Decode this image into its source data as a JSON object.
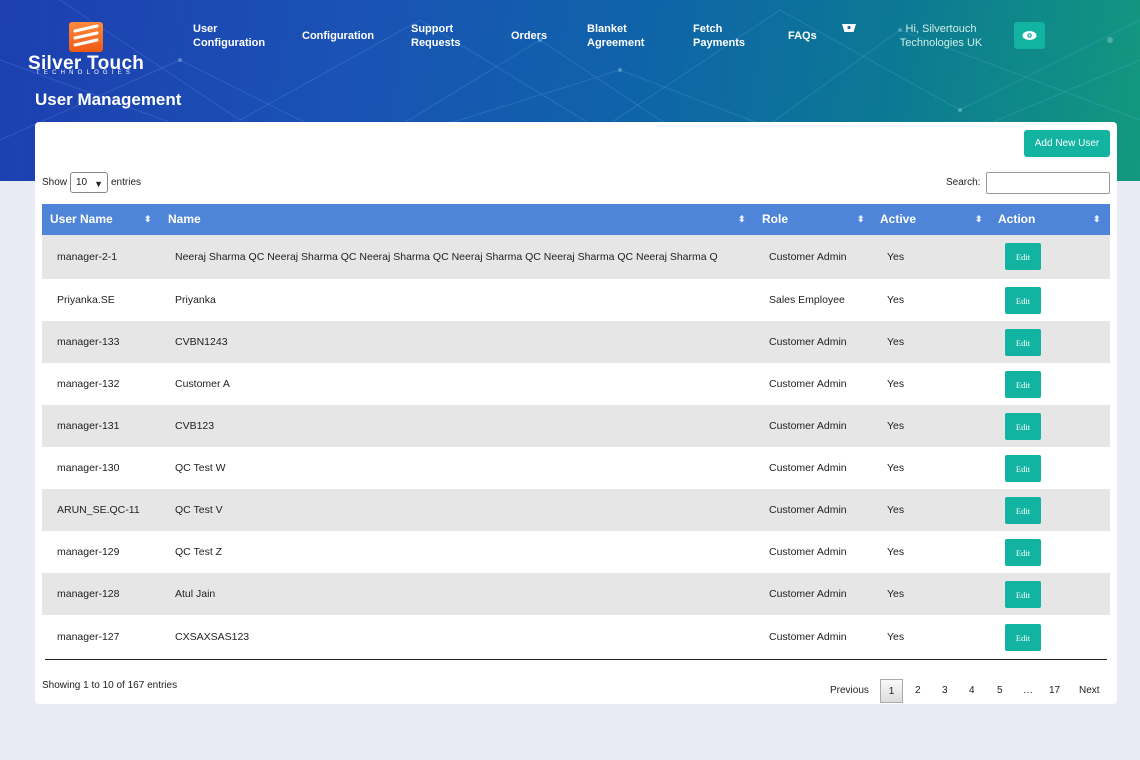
{
  "brand": {
    "name": "Silver Touch",
    "tagline": "TECHNOLOGIES",
    "accent": "#12b3a0",
    "header_blue": "#1d3fb0",
    "table_header": "#4f85d8"
  },
  "nav": [
    {
      "label": "User\nConfiguration"
    },
    {
      "label": "Configuration"
    },
    {
      "label": "Support\nRequests"
    },
    {
      "label": "Orders"
    },
    {
      "label": "Blanket\nAgreement"
    },
    {
      "label": "Fetch\nPayments"
    },
    {
      "label": "FAQs"
    }
  ],
  "header": {
    "greeting": "Hi, Silvertouch\nTechnologies UK",
    "basket_icon": "basket-icon",
    "eye_icon": "eye-icon"
  },
  "page": {
    "title": "User Management",
    "add_button": "Add New User"
  },
  "table_controls": {
    "show_label": "Show",
    "entries_value": "10",
    "entries_label": "entries",
    "search_label": "Search:",
    "search_value": ""
  },
  "columns": [
    "User Name",
    "Name",
    "Role",
    "Active",
    "Action"
  ],
  "rows": [
    {
      "username": "manager-2-1",
      "name": "Neeraj Sharma QC Neeraj Sharma QC Neeraj Sharma QC Neeraj Sharma QC Neeraj Sharma QC Neeraj Sharma Q",
      "role": "Customer Admin",
      "active": "Yes",
      "action": "Edit"
    },
    {
      "username": "Priyanka.SE",
      "name": "Priyanka",
      "role": "Sales Employee",
      "active": "Yes",
      "action": "Edit"
    },
    {
      "username": "manager-133",
      "name": "CVBN1243",
      "role": "Customer Admin",
      "active": "Yes",
      "action": "Edit"
    },
    {
      "username": "manager-132",
      "name": "Customer A",
      "role": "Customer Admin",
      "active": "Yes",
      "action": "Edit"
    },
    {
      "username": "manager-131",
      "name": "CVB123",
      "role": "Customer Admin",
      "active": "Yes",
      "action": "Edit"
    },
    {
      "username": "manager-130",
      "name": "QC Test W",
      "role": "Customer Admin",
      "active": "Yes",
      "action": "Edit"
    },
    {
      "username": "ARUN_SE.QC-11",
      "name": "QC Test V",
      "role": "Customer Admin",
      "active": "Yes",
      "action": "Edit"
    },
    {
      "username": "manager-129",
      "name": "QC Test Z",
      "role": "Customer Admin",
      "active": "Yes",
      "action": "Edit"
    },
    {
      "username": "manager-128",
      "name": "Atul Jain",
      "role": "Customer Admin",
      "active": "Yes",
      "action": "Edit"
    },
    {
      "username": "manager-127",
      "name": "CXSAXSAS123",
      "role": "Customer Admin",
      "active": "Yes",
      "action": "Edit"
    }
  ],
  "footer": {
    "info": "Showing 1 to 10 of 167 entries",
    "previous": "Previous",
    "pages": [
      "1",
      "2",
      "3",
      "4",
      "5",
      "…",
      "17"
    ],
    "current_page": "1",
    "next": "Next"
  }
}
